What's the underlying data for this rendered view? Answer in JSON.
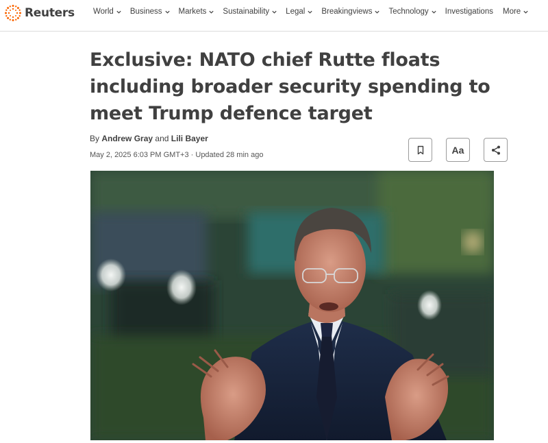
{
  "brand": {
    "name": "Reuters"
  },
  "nav": {
    "items": [
      {
        "label": "World",
        "has_dropdown": true
      },
      {
        "label": "Business",
        "has_dropdown": true
      },
      {
        "label": "Markets",
        "has_dropdown": true
      },
      {
        "label": "Sustainability",
        "has_dropdown": true
      },
      {
        "label": "Legal",
        "has_dropdown": true
      },
      {
        "label": "Breakingviews",
        "has_dropdown": true
      },
      {
        "label": "Technology",
        "has_dropdown": true
      },
      {
        "label": "Investigations",
        "has_dropdown": false
      }
    ],
    "more_label": "More"
  },
  "article": {
    "headline": "Exclusive: NATO chief Rutte floats including broader security spending to meet Trump defence target",
    "byline_prefix": "By",
    "author_1": "Andrew Gray",
    "byline_and": "and",
    "author_2": "Lili Bayer",
    "dateline": "May 2, 2025 6:03 PM GMT+3 · Updated 28 min ago",
    "text_size_label": "Aa"
  },
  "icons": {
    "logo": "reuters-logo-icon",
    "bookmark": "bookmark-icon",
    "share": "share-icon",
    "chevron": "chevron-down-icon"
  },
  "colors": {
    "text": "#404040",
    "logo_orange": "#fa6400",
    "border": "#9a9a9a"
  }
}
